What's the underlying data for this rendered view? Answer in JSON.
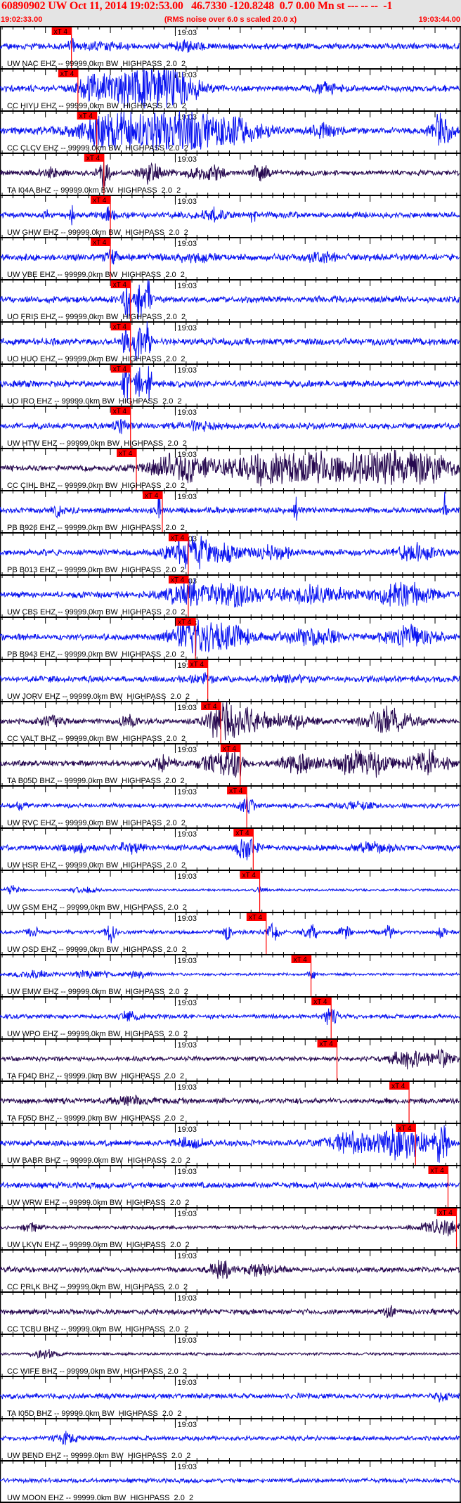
{
  "header": {
    "title": "60890902 UW Oct 11, 2014 19:02:53.00   46.7330 -120.8248  0.7 0.00 Mn st --- -- --  -1",
    "start_time": "19:02:33.00",
    "rms_note": "(RMS noise over 6.0 s scaled 20.0 x)",
    "end_time": "19:03:44.00"
  },
  "time_axis": {
    "duration_s": 71,
    "major_tick_s": 10,
    "minor_per_major": 6,
    "minute_mark_s": 27,
    "minute_label": "19:03"
  },
  "pick_label": "xT 4",
  "colors": {
    "ehz": "#0a14f0",
    "bhz": "#26084f",
    "pick": "#ff0000",
    "header_text": "#ff0000"
  },
  "traces": [
    {
      "label": "UW NAC EHZ -- 99999.0km BW  HIGHPASS  2.0  2",
      "ch": "ehz",
      "pick_s": 11.0,
      "noise": 0.14,
      "bursts": [
        [
          11,
          0.6,
          0.4
        ],
        [
          16,
          0.2,
          3
        ],
        [
          29,
          0.3,
          2
        ]
      ]
    },
    {
      "label": "CC HIYU EHZ -- 99999.0km BW  HIGHPASS  2.0  2",
      "ch": "ehz",
      "pick_s": 12.0,
      "noise": 0.15,
      "bursts": [
        [
          14,
          0.6,
          2
        ],
        [
          19,
          0.9,
          4
        ],
        [
          24,
          1.1,
          5
        ],
        [
          27,
          1.1,
          3
        ],
        [
          50,
          0.4,
          1.5
        ]
      ]
    },
    {
      "label": "CC CLCV EHZ -- 99999.0km BW  HIGHPASS  2.0  2",
      "ch": "ehz",
      "pick_s": 14.9,
      "noise": 0.15,
      "bursts": [
        [
          15,
          0.6,
          2
        ],
        [
          22,
          1.2,
          9
        ],
        [
          30,
          1,
          4
        ],
        [
          37,
          0.7,
          4
        ],
        [
          50,
          0.4,
          2
        ],
        [
          68,
          1.2,
          1.5
        ]
      ]
    },
    {
      "label": "TA I04A BHZ -- 99999.0km BW  HIGHPASS  2.0  2",
      "ch": "bhz",
      "pick_s": 16.0,
      "noise": 0.12,
      "bursts": [
        [
          8,
          0.25,
          2
        ],
        [
          16,
          0.8,
          1
        ],
        [
          24,
          0.3,
          2
        ],
        [
          23,
          0.5,
          1.5
        ],
        [
          30,
          0.3,
          2
        ],
        [
          33,
          0.45,
          1.5
        ],
        [
          40,
          0.5,
          1.5
        ]
      ]
    },
    {
      "label": "UW GHW EHZ -- 99999.0km BW  HIGHPASS  2.0  2",
      "ch": "ehz",
      "pick_s": 17.0,
      "noise": 0.14,
      "bursts": [
        [
          7,
          0.5,
          0.3
        ],
        [
          11,
          0.6,
          0.3
        ],
        [
          17,
          0.4,
          1
        ],
        [
          39,
          0.5,
          0.5
        ],
        [
          33,
          0.3,
          2
        ]
      ]
    },
    {
      "label": "UW VBE EHZ -- 99999.0km BW  HIGHPASS  2.0  2",
      "ch": "ehz",
      "pick_s": 17.0,
      "noise": 0.15,
      "bursts": [
        [
          17,
          0.5,
          1
        ],
        [
          30,
          0.25,
          3
        ],
        [
          50,
          0.2,
          3
        ]
      ]
    },
    {
      "label": "UO FRIS EHZ -- 99999.0km BW  HIGHPASS  2.0  2",
      "ch": "ehz",
      "pick_s": 20.1,
      "noise": 0.15,
      "bursts": [
        [
          19.5,
          2,
          0.5
        ],
        [
          21.3,
          2,
          0.5
        ],
        [
          22.8,
          2,
          0.4
        ]
      ]
    },
    {
      "label": "UO HUO EHZ -- 99999.0km BW  HIGHPASS  2.0  2",
      "ch": "ehz",
      "pick_s": 20.1,
      "noise": 0.16,
      "bursts": [
        [
          19.5,
          2,
          0.5
        ],
        [
          21.3,
          2,
          0.5
        ],
        [
          22.8,
          2,
          0.4
        ]
      ]
    },
    {
      "label": "UO IRO EHZ -- 99999.0km BW  HIGHPASS  2.0  2",
      "ch": "ehz",
      "pick_s": 20.1,
      "noise": 0.15,
      "bursts": [
        [
          19.5,
          2,
          0.5
        ],
        [
          21.3,
          2,
          0.5
        ],
        [
          23.0,
          2,
          0.4
        ]
      ]
    },
    {
      "label": "UW HTW EHZ -- 99999.0km BW  HIGHPASS  2.0  2",
      "ch": "ehz",
      "pick_s": 20.1,
      "noise": 0.14,
      "bursts": [
        [
          18.5,
          0.4,
          1
        ],
        [
          30,
          0.2,
          3
        ]
      ]
    },
    {
      "label": "CC CIHL BHZ -- 99999.0km BW  HIGHPASS  2.0  2",
      "ch": "bhz",
      "pick_s": 21.0,
      "noise": 0.14,
      "bursts": [
        [
          28,
          0.9,
          5
        ],
        [
          40,
          1,
          5
        ],
        [
          48,
          0.8,
          5
        ],
        [
          58,
          1,
          6
        ],
        [
          66,
          0.9,
          4
        ]
      ]
    },
    {
      "label": "PB B926 EHZ -- 99999.0km BW  HIGHPASS  2.0  2",
      "ch": "ehz",
      "pick_s": 25.0,
      "noise": 0.14,
      "bursts": [
        [
          9,
          0.4,
          0.8
        ],
        [
          24.5,
          1.5,
          0.2
        ],
        [
          45.5,
          1.5,
          0.2
        ],
        [
          68.5,
          2,
          0.2
        ]
      ]
    },
    {
      "label": "PB B013 EHZ -- 99999.0km BW  HIGHPASS  2.0  2",
      "ch": "ehz",
      "pick_s": 29.0,
      "noise": 0.14,
      "bursts": [
        [
          29,
          0.9,
          3
        ],
        [
          34,
          0.6,
          3
        ],
        [
          42,
          0.35,
          3
        ],
        [
          64,
          0.5,
          3
        ]
      ]
    },
    {
      "label": "UW CBS EHZ -- 99999.0km BW  HIGHPASS  2.0  2",
      "ch": "ehz",
      "pick_s": 29.0,
      "noise": 0.15,
      "bursts": [
        [
          29,
          0.8,
          3
        ],
        [
          36,
          0.7,
          4
        ],
        [
          48,
          0.6,
          5
        ],
        [
          62,
          0.8,
          4
        ]
      ]
    },
    {
      "label": "PB B943 EHZ -- 99999.0km BW  HIGHPASS  2.0  2",
      "ch": "ehz",
      "pick_s": 30.1,
      "noise": 0.15,
      "bursts": [
        [
          29.5,
          1,
          3
        ],
        [
          35,
          0.7,
          4
        ],
        [
          48,
          0.5,
          4
        ],
        [
          63,
          0.6,
          4
        ]
      ]
    },
    {
      "label": "UW JORV EHZ -- 99999.0km BW  HIGHPASS  2.0  2",
      "ch": "ehz",
      "pick_s": 32.0,
      "noise": 0.14,
      "bursts": [
        [
          31,
          0.3,
          1.5
        ],
        [
          45,
          0.2,
          3
        ]
      ]
    },
    {
      "label": "CC VALT BHZ -- 99999.0km BW  HIGHPASS  2.0  2",
      "ch": "bhz",
      "pick_s": 34.0,
      "noise": 0.12,
      "bursts": [
        [
          8,
          0.3,
          2
        ],
        [
          20,
          0.3,
          2
        ],
        [
          34,
          1.2,
          2
        ],
        [
          38,
          0.8,
          3
        ],
        [
          45,
          0.5,
          3
        ],
        [
          60,
          0.8,
          4
        ]
      ]
    },
    {
      "label": "TA B05D BHZ -- 99999.0km BW  HIGHPASS  2.0  2",
      "ch": "bhz",
      "pick_s": 37.0,
      "noise": 0.13,
      "bursts": [
        [
          25,
          0.5,
          1.5
        ],
        [
          33,
          0.6,
          2.5
        ],
        [
          36,
          0.9,
          1.5
        ],
        [
          46,
          0.6,
          3
        ],
        [
          56,
          0.9,
          4
        ],
        [
          66,
          0.7,
          3
        ]
      ]
    },
    {
      "label": "UW RVC EHZ -- 99999.0km BW  HIGHPASS  2.0  2",
      "ch": "ehz",
      "pick_s": 38.0,
      "noise": 0.1,
      "bursts": [
        [
          3,
          0.3,
          1
        ],
        [
          38,
          0.6,
          1
        ],
        [
          55,
          0.2,
          3
        ]
      ]
    },
    {
      "label": "UW HSR EHZ -- 99999.0km BW  HIGHPASS  2.0  2",
      "ch": "ehz",
      "pick_s": 39.0,
      "noise": 0.13,
      "bursts": [
        [
          12,
          0.3,
          2
        ],
        [
          20,
          0.3,
          2
        ],
        [
          38,
          0.8,
          1.5
        ],
        [
          58,
          0.3,
          3
        ]
      ]
    },
    {
      "label": "UW GSM EHZ -- 99999.0km BW  HIGHPASS  2.0  2",
      "ch": "ehz",
      "pick_s": 40.0,
      "noise": 0.05,
      "bursts": [
        [
          2,
          0.3,
          1
        ],
        [
          13,
          0.2,
          2
        ],
        [
          40,
          0.15,
          1
        ]
      ]
    },
    {
      "label": "UW OSD EHZ -- 99999.0km BW  HIGHPASS  2.0  2",
      "ch": "ehz",
      "pick_s": 41.0,
      "noise": 0.09,
      "bursts": [
        [
          5,
          0.3,
          1
        ],
        [
          17,
          0.6,
          0.8
        ],
        [
          35,
          0.5,
          0.6
        ],
        [
          42,
          0.5,
          1
        ],
        [
          48,
          0.5,
          1
        ],
        [
          53,
          0.4,
          1
        ],
        [
          60,
          0.5,
          0.6
        ],
        [
          68,
          0.4,
          0.6
        ]
      ]
    },
    {
      "label": "UW EMW EHZ -- 99999.0km BW  HIGHPASS  2.0  2",
      "ch": "ehz",
      "pick_s": 47.9,
      "noise": 0.06,
      "bursts": [
        [
          5,
          0.25,
          3
        ],
        [
          14,
          0.25,
          3
        ],
        [
          21,
          0.2,
          2
        ],
        [
          48,
          0.35,
          0.5
        ]
      ]
    },
    {
      "label": "UW WPO EHZ -- 99999.0km BW  HIGHPASS  2.0  2",
      "ch": "ehz",
      "pick_s": 51.0,
      "noise": 0.1,
      "bursts": [
        [
          20,
          0.3,
          1.5
        ],
        [
          51,
          0.6,
          1
        ]
      ]
    },
    {
      "label": "TA F04D BHZ -- 99999.0km BW  HIGHPASS  2.0  2",
      "ch": "bhz",
      "pick_s": 51.9,
      "noise": 0.1,
      "bursts": [
        [
          63,
          0.6,
          3
        ],
        [
          68,
          0.5,
          2
        ]
      ]
    },
    {
      "label": "TA F05D BHZ -- 99999.0km BW  HIGHPASS  2.0  2",
      "ch": "bhz",
      "pick_s": 63.0,
      "noise": 0.13,
      "bursts": [
        [
          20,
          0.2,
          3
        ]
      ]
    },
    {
      "label": "UW BABR BHZ -- 99999.0km BW  HIGHPASS  2.0  2",
      "ch": "ehz",
      "pick_s": 64.0,
      "noise": 0.14,
      "bursts": [
        [
          29,
          0.3,
          2
        ],
        [
          54,
          0.6,
          4
        ],
        [
          62,
          1,
          4
        ],
        [
          68,
          1.5,
          1
        ]
      ]
    },
    {
      "label": "UW WRW EHZ -- 99999.0km BW  HIGHPASS  2.0  2",
      "ch": "ehz",
      "pick_s": 69.0,
      "noise": 0.14,
      "bursts": []
    },
    {
      "label": "UW LKVN EHZ -- 99999.0km BW  HIGHPASS  2.0  2",
      "ch": "bhz",
      "pick_s": 70.3,
      "noise": 0.08,
      "bursts": [
        [
          5,
          0.3,
          1.5
        ],
        [
          68,
          0.5,
          3
        ]
      ]
    },
    {
      "label": "CC PRLK BHZ -- 99999.0km BW  HIGHPASS  2.0  2",
      "ch": "bhz",
      "pick_s": null,
      "noise": 0.12,
      "bursts": [
        [
          34,
          0.6,
          1.5
        ],
        [
          40,
          0.3,
          3
        ]
      ]
    },
    {
      "label": "CC TCBU BHZ -- 99999.0km BW  HIGHPASS  2.0  2",
      "ch": "bhz",
      "pick_s": null,
      "noise": 0.12,
      "bursts": [
        [
          60,
          0.3,
          1
        ]
      ]
    },
    {
      "label": "CC WIFE BHZ -- 99999.0km BW  HIGHPASS  2.0  2",
      "ch": "bhz",
      "pick_s": null,
      "noise": 0.06,
      "bursts": [
        [
          7,
          0.3,
          2
        ]
      ]
    },
    {
      "label": "TA I05D BHZ -- 99999.0km BW  HIGHPASS  2.0  2",
      "ch": "ehz",
      "pick_s": null,
      "noise": 0.12,
      "bursts": [
        [
          68,
          0.3,
          1
        ]
      ]
    },
    {
      "label": "UW BEND EHZ -- 99999.0km BW  HIGHPASS  2.0  2",
      "ch": "ehz",
      "pick_s": null,
      "noise": 0.1,
      "bursts": [
        [
          10,
          0.3,
          2
        ]
      ]
    },
    {
      "label": "UW MOON EHZ -- 99999.0km BW  HIGHPASS  2.0  2",
      "ch": "ehz",
      "pick_s": null,
      "noise": 0.1,
      "bursts": []
    }
  ]
}
